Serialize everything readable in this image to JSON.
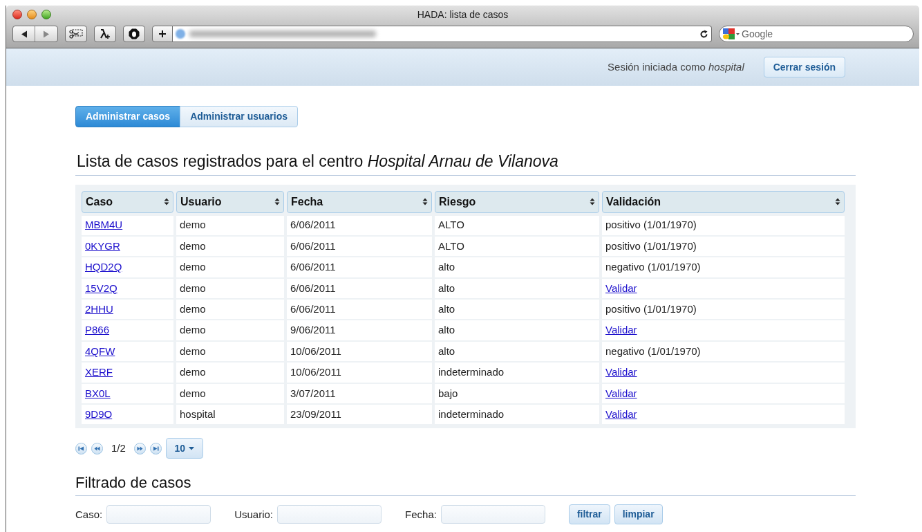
{
  "window": {
    "title": "HADA: lista de casos"
  },
  "browser": {
    "search_placeholder": "Google"
  },
  "session": {
    "label": "Sesión iniciada como *hospital*",
    "logout": "Cerrar sesión"
  },
  "tabs": [
    {
      "label": "Administrar casos",
      "selected": true
    },
    {
      "label": "Administrar usuarios",
      "selected": false
    }
  ],
  "heading": "Lista de casos registrados para el centro *Hospital Arnau de Vilanova*",
  "table": {
    "columns": [
      "Caso",
      "Usuario",
      "Fecha",
      "Riesgo",
      "Validación"
    ],
    "rows": [
      {
        "caso": "MBM4U",
        "usuario": "demo",
        "fecha": "6/06/2011",
        "riesgo": "ALTO",
        "validacion": {
          "kind": "text",
          "text": "positivo (1/01/1970)"
        }
      },
      {
        "caso": "0KYGR",
        "usuario": "demo",
        "fecha": "6/06/2011",
        "riesgo": "ALTO",
        "validacion": {
          "kind": "text",
          "text": "positivo (1/01/1970)"
        }
      },
      {
        "caso": "HQD2Q",
        "usuario": "demo",
        "fecha": "6/06/2011",
        "riesgo": "alto",
        "validacion": {
          "kind": "text",
          "text": "negativo (1/01/1970)"
        }
      },
      {
        "caso": "15V2Q",
        "usuario": "demo",
        "fecha": "6/06/2011",
        "riesgo": "alto",
        "validacion": {
          "kind": "link",
          "text": "Validar"
        }
      },
      {
        "caso": "2HHU",
        "usuario": "demo",
        "fecha": "6/06/2011",
        "riesgo": "alto",
        "validacion": {
          "kind": "text",
          "text": "positivo (1/01/1970)"
        }
      },
      {
        "caso": "P866",
        "usuario": "demo",
        "fecha": "9/06/2011",
        "riesgo": "alto",
        "validacion": {
          "kind": "link",
          "text": "Validar"
        }
      },
      {
        "caso": "4QFW",
        "usuario": "demo",
        "fecha": "10/06/2011",
        "riesgo": "alto",
        "validacion": {
          "kind": "text",
          "text": "negativo (1/01/1970)"
        }
      },
      {
        "caso": "XERF",
        "usuario": "demo",
        "fecha": "10/06/2011",
        "riesgo": "indeterminado",
        "validacion": {
          "kind": "link",
          "text": "Validar"
        }
      },
      {
        "caso": "BX0L",
        "usuario": "demo",
        "fecha": "3/07/2011",
        "riesgo": "bajo",
        "validacion": {
          "kind": "link",
          "text": "Validar"
        }
      },
      {
        "caso": "9D9O",
        "usuario": "hospital",
        "fecha": "23/09/2011",
        "riesgo": "indeterminado",
        "validacion": {
          "kind": "link",
          "text": "Validar"
        }
      }
    ]
  },
  "pagination": {
    "page": "1/2",
    "page_size": "10"
  },
  "filter": {
    "heading": "Filtrado de casos",
    "fields": [
      "Caso:",
      "Usuario:",
      "Fecha:"
    ],
    "buttons": [
      "filtrar",
      "limpiar"
    ]
  }
}
